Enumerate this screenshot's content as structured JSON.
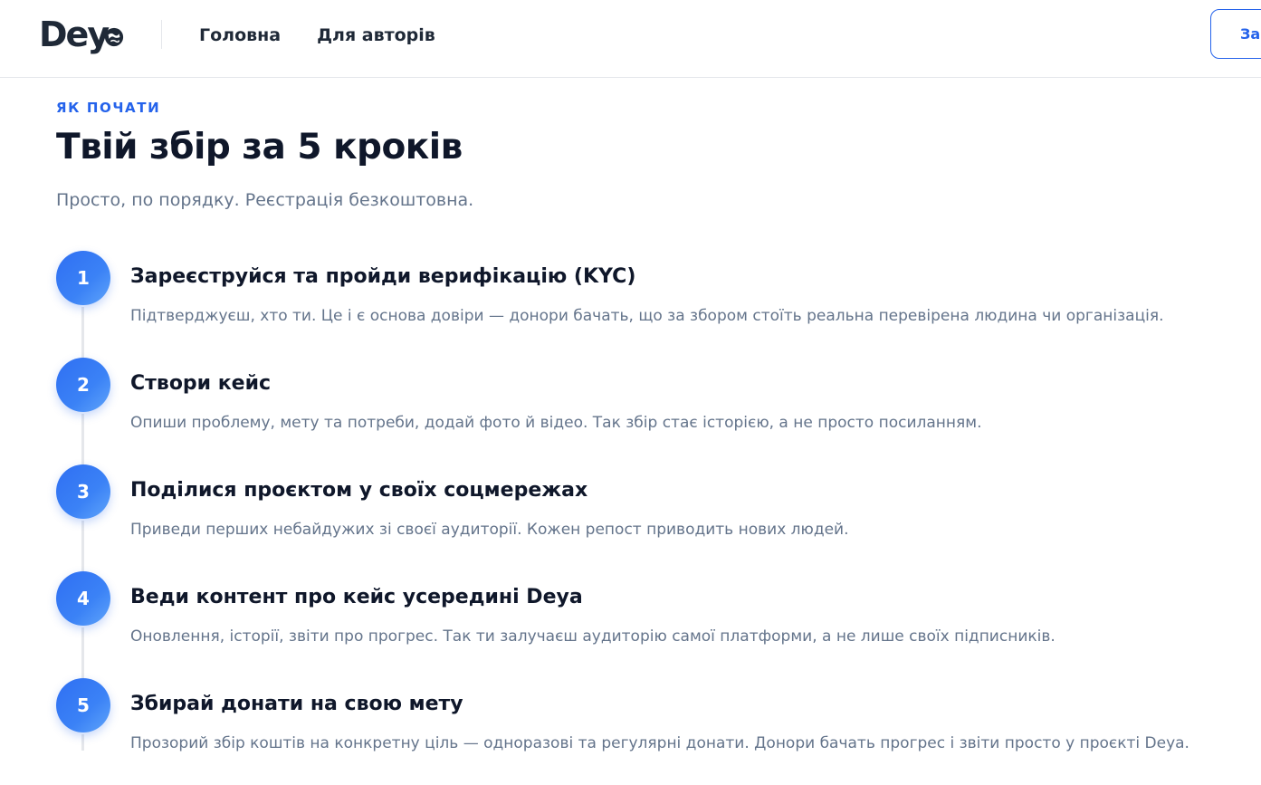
{
  "header": {
    "logo_text": "Dey",
    "nav": [
      {
        "label": "Головна"
      },
      {
        "label": "Для авторів"
      }
    ],
    "cta_label": "Залишити заявку",
    "accent_color": "#2563eb"
  },
  "main": {
    "eyebrow": "ЯК ПОЧАТИ",
    "title": "Твій збір за 5 кроків",
    "subtitle": "Просто, по порядку. Реєстрація безкоштовна.",
    "steps": [
      {
        "number": "1",
        "title": "Зареєструйся та пройди верифікацію (KYC)",
        "description": "Підтверджуєш, хто ти. Це і є основа довіри — донори бачать, що за збором стоїть реальна перевірена людина чи організація."
      },
      {
        "number": "2",
        "title": "Створи кейс",
        "description": "Опиши проблему, мету та потреби, додай фото й відео. Так збір стає історією, а не просто посиланням."
      },
      {
        "number": "3",
        "title": "Поділися проєктом у своїх соцмережах",
        "description": "Приведи перших небайдужих зі своєї аудиторії. Кожен репост приводить нових людей."
      },
      {
        "number": "4",
        "title": "Веди контент про кейс усередині Deya",
        "description": "Оновлення, історії, звіти про прогрес. Так ти залучаєш аудиторію самої платформи, а не лише своїх підписників."
      },
      {
        "number": "5",
        "title": "Збирай донати на свою мету",
        "description": "Прозорий збір коштів на конкретну ціль — одноразові та регулярні донати. Донори бачать прогрес і звіти просто у проєкті Deya."
      }
    ]
  }
}
